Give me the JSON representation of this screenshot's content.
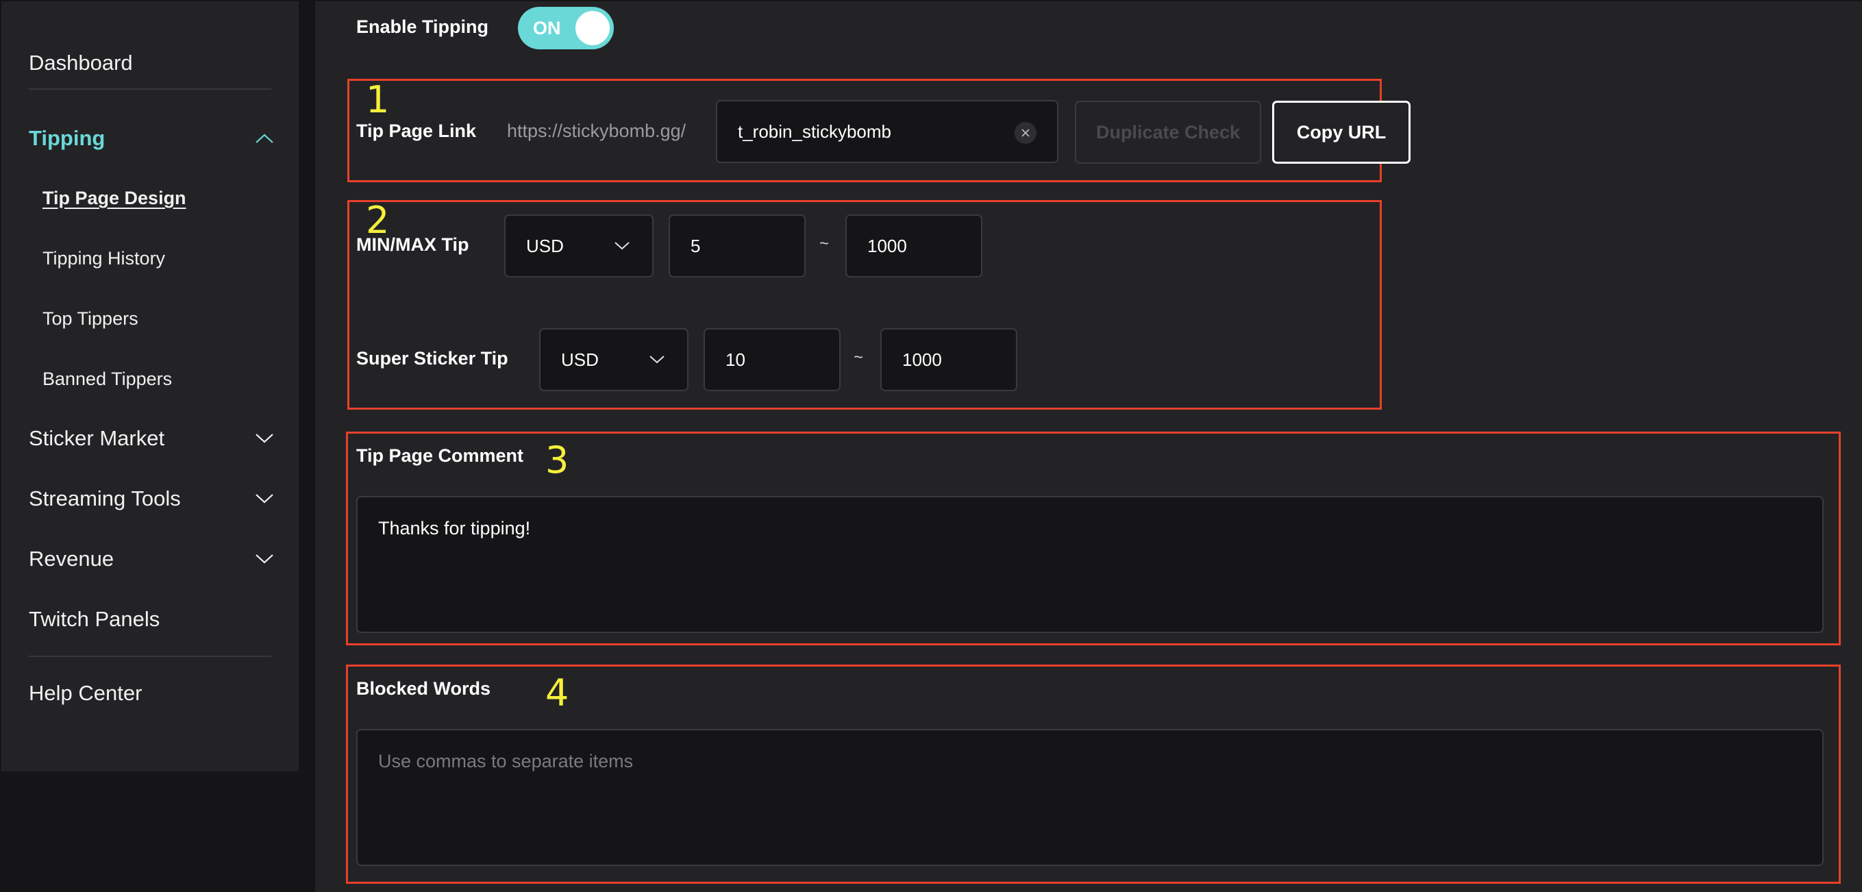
{
  "sidebar": {
    "items": [
      {
        "label": "Dashboard",
        "expandable": false
      },
      {
        "label": "Tipping",
        "expandable": true,
        "expanded": true,
        "active": true,
        "children": [
          {
            "label": "Tip Page Design",
            "current": true
          },
          {
            "label": "Tipping History"
          },
          {
            "label": "Top Tippers"
          },
          {
            "label": "Banned Tippers"
          }
        ]
      },
      {
        "label": "Sticker Market",
        "expandable": true,
        "expanded": false
      },
      {
        "label": "Streaming Tools",
        "expandable": true,
        "expanded": false
      },
      {
        "label": "Revenue",
        "expandable": true,
        "expanded": false
      },
      {
        "label": "Twitch Panels",
        "expandable": false
      },
      {
        "label": "Help Center",
        "expandable": false
      }
    ],
    "accent_color": "#6bd8d8"
  },
  "main": {
    "enable_tipping": {
      "label": "Enable Tipping",
      "state_label": "ON",
      "on": true
    },
    "annotations": {
      "color": "#e8402a",
      "marker_color": "#f5f03a",
      "markers": [
        "1",
        "2",
        "3",
        "4"
      ]
    },
    "tip_page_link": {
      "label": "Tip Page Link",
      "prefix": "https://stickybomb.gg/",
      "value": "t_robin_stickybomb",
      "clear_icon": "close-icon",
      "duplicate_check_label": "Duplicate Check",
      "copy_url_label": "Copy URL"
    },
    "min_max_tip": {
      "label": "MIN/MAX Tip",
      "currency": "USD",
      "min": "5",
      "separator": "~",
      "max": "1000"
    },
    "super_sticker_tip": {
      "label": "Super Sticker Tip",
      "currency": "USD",
      "min": "10",
      "separator": "~",
      "max": "1000"
    },
    "tip_page_comment": {
      "label": "Tip Page Comment",
      "value": "Thanks for tipping!"
    },
    "blocked_words": {
      "label": "Blocked Words",
      "value": "",
      "placeholder": "Use commas to separate items"
    }
  }
}
